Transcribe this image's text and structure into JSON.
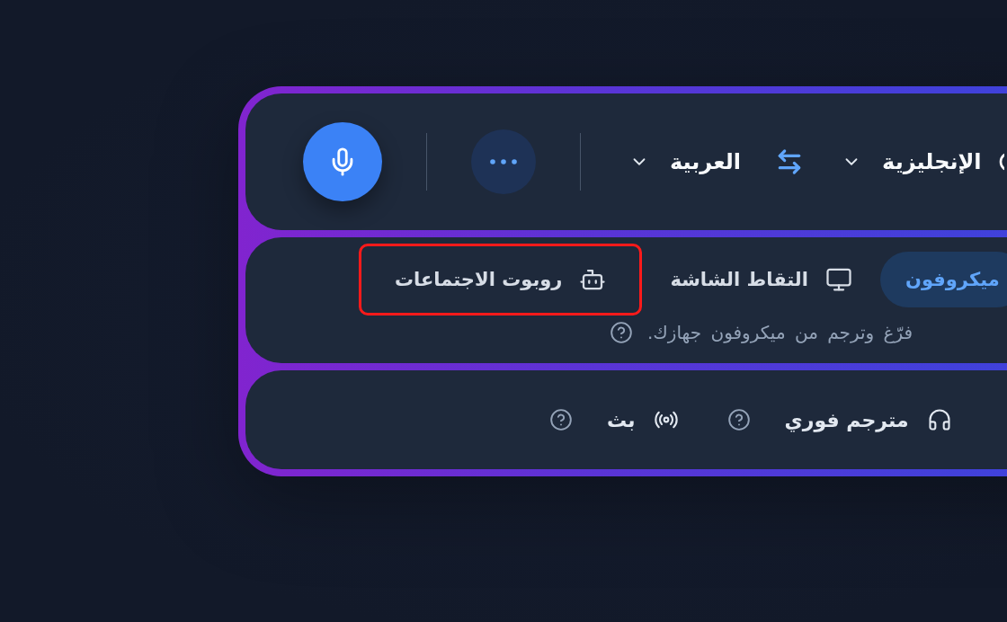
{
  "language_bar": {
    "source_language": {
      "label": "الإنجليزية"
    },
    "target_language": {
      "label": "العربية"
    }
  },
  "input_sources": {
    "tabs": [
      {
        "kind": "microphone",
        "label": "ميكروفون",
        "selected": true,
        "highlighted": false
      },
      {
        "kind": "screen",
        "label": "التقاط الشاشة",
        "selected": false,
        "highlighted": false
      },
      {
        "kind": "bot",
        "label": "روبوت الاجتماعات",
        "selected": false,
        "highlighted": true
      }
    ],
    "hint": "فرّغ وترجم من ميكروفون جهازك."
  },
  "modes": [
    {
      "kind": "interpreter",
      "label": "مترجم فوري"
    },
    {
      "kind": "broadcast",
      "label": "بث"
    }
  ]
}
